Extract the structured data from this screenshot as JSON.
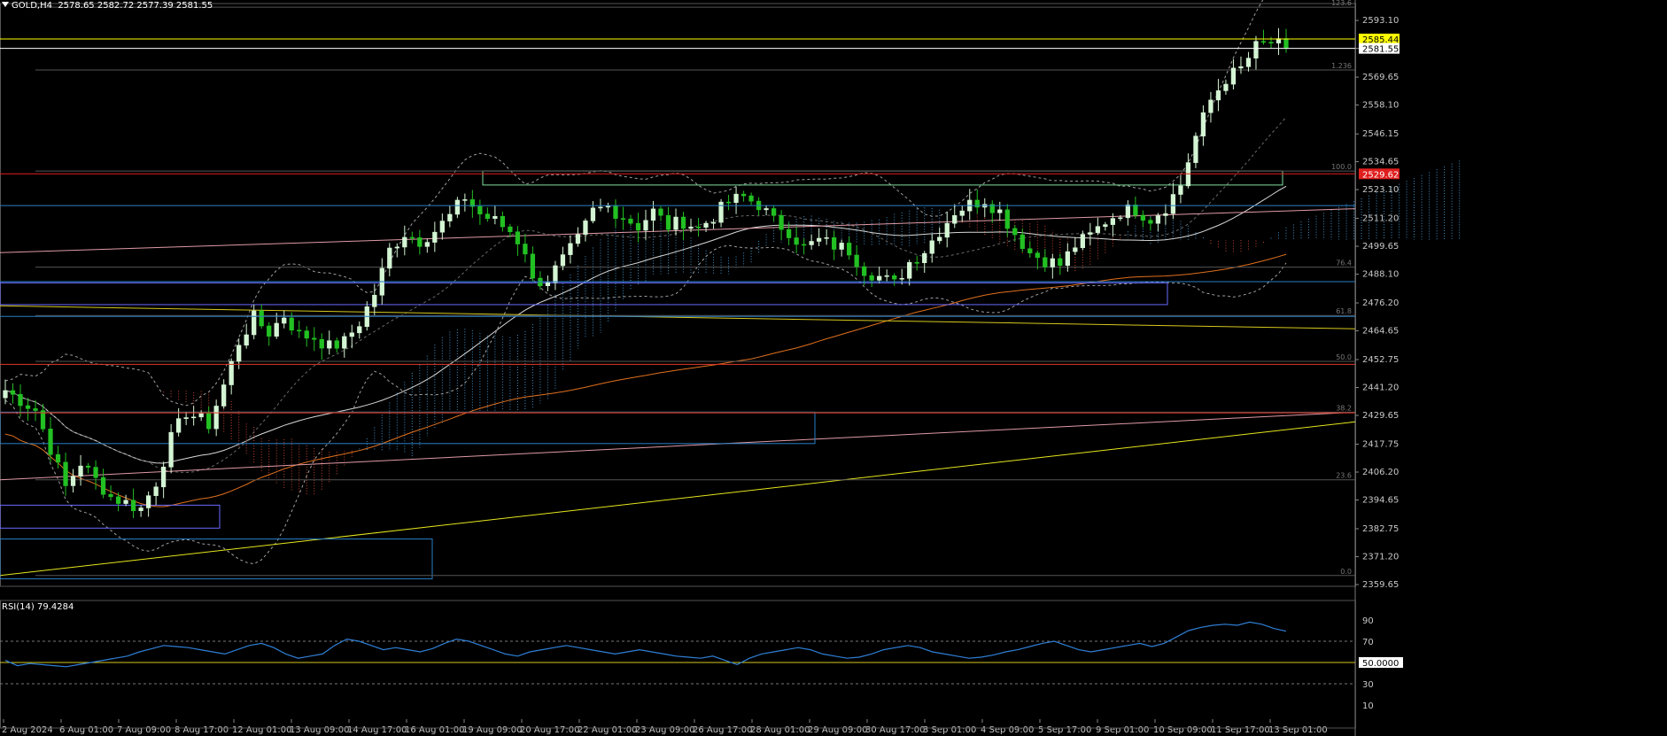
{
  "header": {
    "symbol": "GOLD,H4",
    "ohlc": "2578.65 2582.72 2577.39 2581.55"
  },
  "colors": {
    "background": "#000000",
    "bull_candle": "#d4f5d4",
    "bear_candle": "#22c022",
    "axis_text": "#c8c8c8",
    "rsi_line": "#2f7fd6",
    "ask_label": "#ffff00",
    "bid_label": "#ffffff",
    "red_label": "#e01e1e"
  },
  "chart_data": [
    {
      "type": "candlestick",
      "symbol": "GOLD",
      "timeframe": "H4",
      "ylim": [
        2359.65,
        2600.1
      ],
      "y_ticks": [
        "2593.10",
        "2581.55",
        "2569.65",
        "2558.10",
        "2546.15",
        "2534.65",
        "2523.10",
        "2511.20",
        "2499.65",
        "2488.10",
        "2476.20",
        "2464.65",
        "2452.75",
        "2441.20",
        "2429.65",
        "2417.75",
        "2406.20",
        "2394.65",
        "2382.75",
        "2371.20",
        "2359.65"
      ],
      "x_labels": [
        "2 Aug 2024",
        "6 Aug 01:00",
        "7 Aug 09:00",
        "8 Aug 17:00",
        "12 Aug 01:00",
        "13 Aug 09:00",
        "14 Aug 17:00",
        "16 Aug 01:00",
        "19 Aug 09:00",
        "20 Aug 17:00",
        "22 Aug 01:00",
        "23 Aug 09:00",
        "26 Aug 17:00",
        "28 Aug 01:00",
        "29 Aug 09:00",
        "30 Aug 17:00",
        "3 Sep 01:00",
        "4 Sep 09:00",
        "5 Sep 17:00",
        "9 Sep 01:00",
        "10 Sep 09:00",
        "11 Sep 17:00",
        "13 Sep 01:00"
      ],
      "close_path": [
        [
          0,
          2440
        ],
        [
          4,
          2432
        ],
        [
          8,
          2400
        ],
        [
          10,
          2410
        ],
        [
          14,
          2396
        ],
        [
          18,
          2391
        ],
        [
          20,
          2402
        ],
        [
          22,
          2420
        ],
        [
          24,
          2431
        ],
        [
          27,
          2426
        ],
        [
          29,
          2442
        ],
        [
          31,
          2460
        ],
        [
          33,
          2470
        ],
        [
          35,
          2464
        ],
        [
          37,
          2471
        ],
        [
          39,
          2463
        ],
        [
          41,
          2462
        ],
        [
          43,
          2458
        ],
        [
          45,
          2460
        ],
        [
          47,
          2468
        ],
        [
          49,
          2480
        ],
        [
          51,
          2498
        ],
        [
          53,
          2505
        ],
        [
          55,
          2502
        ],
        [
          57,
          2506
        ],
        [
          59,
          2512
        ],
        [
          61,
          2520
        ],
        [
          63,
          2513
        ],
        [
          65,
          2510
        ],
        [
          67,
          2506
        ],
        [
          69,
          2498
        ],
        [
          70,
          2485
        ],
        [
          72,
          2486
        ],
        [
          74,
          2494
        ],
        [
          76,
          2502
        ],
        [
          78,
          2514
        ],
        [
          80,
          2516
        ],
        [
          82,
          2512
        ],
        [
          84,
          2508
        ],
        [
          86,
          2514
        ],
        [
          88,
          2508
        ],
        [
          90,
          2510
        ],
        [
          92,
          2507
        ],
        [
          94,
          2512
        ],
        [
          96,
          2518
        ],
        [
          98,
          2520
        ],
        [
          100,
          2517
        ],
        [
          102,
          2510
        ],
        [
          104,
          2506
        ],
        [
          106,
          2499
        ],
        [
          108,
          2502
        ],
        [
          110,
          2500
        ],
        [
          112,
          2498
        ],
        [
          114,
          2490
        ],
        [
          116,
          2487
        ],
        [
          118,
          2484
        ],
        [
          120,
          2493
        ],
        [
          122,
          2498
        ],
        [
          124,
          2506
        ],
        [
          126,
          2514
        ],
        [
          128,
          2517
        ],
        [
          130,
          2519
        ],
        [
          132,
          2514
        ],
        [
          134,
          2505
        ],
        [
          136,
          2497
        ],
        [
          138,
          2494
        ],
        [
          140,
          2492
        ],
        [
          142,
          2500
        ],
        [
          144,
          2504
        ],
        [
          146,
          2510
        ],
        [
          148,
          2514
        ],
        [
          150,
          2515
        ],
        [
          152,
          2511
        ],
        [
          154,
          2516
        ],
        [
          156,
          2525
        ],
        [
          158,
          2545
        ],
        [
          160,
          2560
        ],
        [
          162,
          2569
        ],
        [
          164,
          2573
        ],
        [
          166,
          2582
        ],
        [
          168,
          2584
        ],
        [
          170,
          2581.55
        ]
      ],
      "horizontal_levels": [
        {
          "price": 2585.44,
          "color": "#ffff00",
          "label": "2585.44"
        },
        {
          "price": 2581.55,
          "color": "#ffffff",
          "label": "2581.55"
        },
        {
          "price": 2529.62,
          "color": "#e01e1e",
          "label": "2529.62"
        },
        {
          "price": 2516.5,
          "color": "#2a7fc8"
        },
        {
          "price": 2485.0,
          "color": "#2a7fc8"
        },
        {
          "price": 2470.6,
          "color": "#2a7fc8"
        },
        {
          "price": 2450.8,
          "color": "#e03a2a"
        },
        {
          "price": 2430.7,
          "color": "#e03a2a"
        }
      ],
      "fib_levels": [
        {
          "label": "123.6",
          "price": 2598.6
        },
        {
          "label": "1.236",
          "price": 2572.6
        },
        {
          "label": "100.0",
          "price": 2530.8
        },
        {
          "label": "76.4",
          "price": 2491.0
        },
        {
          "label": "61.8",
          "price": 2471.0
        },
        {
          "label": "50.0",
          "price": 2452.0
        },
        {
          "label": "38.2",
          "price": 2431.0
        },
        {
          "label": "23.6",
          "price": 2403.0
        },
        {
          "label": "0.0",
          "price": 2363.4
        }
      ]
    },
    {
      "type": "line",
      "name": "RSI(14)",
      "title": "RSI(14) 79.4284",
      "levels": [
        "90",
        "70",
        "50.0000",
        "30",
        "10"
      ],
      "ylim": [
        0,
        100
      ],
      "values": [
        52,
        47,
        49,
        48,
        47,
        46,
        48,
        50,
        52,
        54,
        56,
        60,
        63,
        66,
        65,
        64,
        62,
        60,
        58,
        62,
        66,
        68,
        64,
        58,
        54,
        56,
        58,
        66,
        72,
        70,
        66,
        62,
        64,
        62,
        60,
        63,
        68,
        72,
        70,
        66,
        62,
        58,
        56,
        60,
        62,
        64,
        66,
        64,
        62,
        60,
        58,
        60,
        62,
        60,
        58,
        56,
        55,
        54,
        56,
        52,
        48,
        54,
        58,
        60,
        62,
        64,
        62,
        58,
        56,
        54,
        55,
        58,
        62,
        64,
        66,
        64,
        60,
        58,
        56,
        54,
        55,
        57,
        60,
        62,
        65,
        68,
        70,
        66,
        62,
        60,
        62,
        64,
        66,
        68,
        65,
        68,
        74,
        80,
        83,
        85,
        86,
        85,
        88,
        86,
        82,
        79.43
      ]
    }
  ]
}
